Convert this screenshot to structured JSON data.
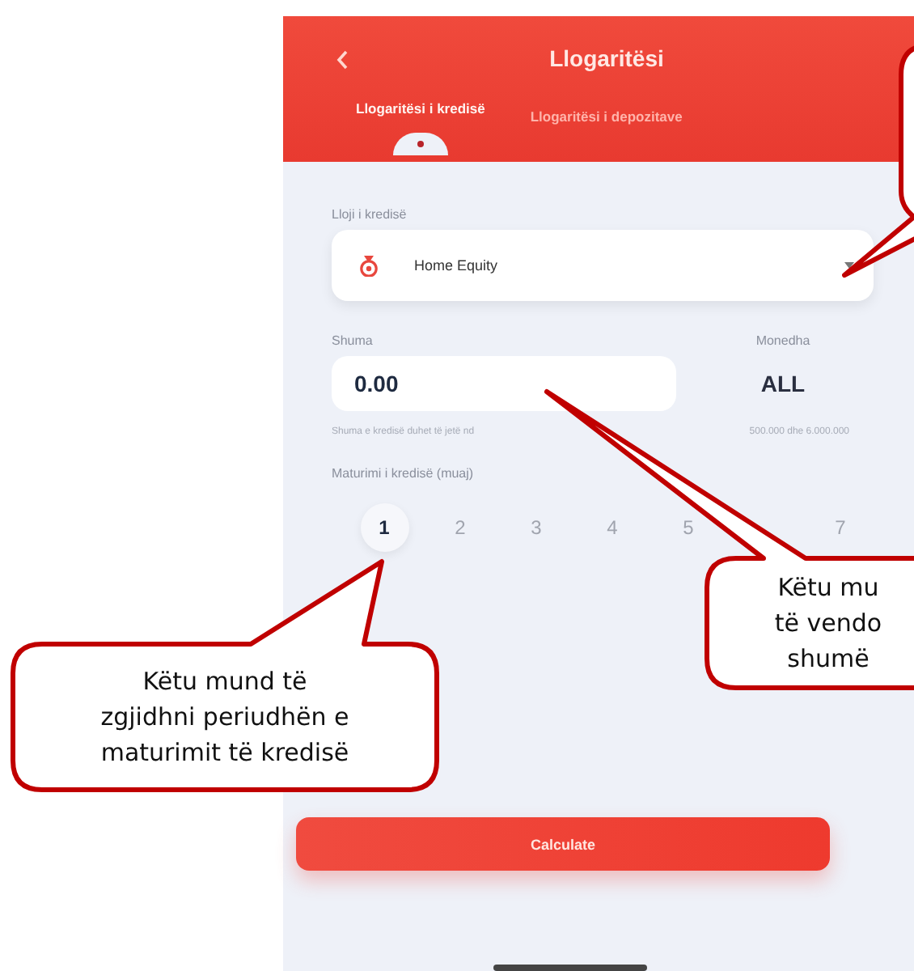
{
  "header": {
    "title": "Llogaritësi"
  },
  "tabs": [
    {
      "label": "Llogaritësi i kredisë",
      "selected": true
    },
    {
      "label": "Llogaritësi i depozitave",
      "selected": false
    }
  ],
  "loan_type": {
    "label": "Lloji i kredisë",
    "value": "Home Equity"
  },
  "amount": {
    "label": "Shuma",
    "value": "0.00"
  },
  "currency": {
    "label": "Monedha",
    "value": "ALL"
  },
  "hint": [
    "Shuma e kredisë duhet të jetë nd",
    "500.000 dhe 6.000.000"
  ],
  "maturity": {
    "label": "Maturimi i kredisë (muaj)",
    "months": [
      {
        "label": "1",
        "selected": true
      },
      {
        "label": "2",
        "selected": false
      },
      {
        "label": "3",
        "selected": false
      },
      {
        "label": "4",
        "selected": false
      },
      {
        "label": "5",
        "selected": false
      },
      {
        "label": "7",
        "selected": false
      }
    ]
  },
  "button": "Calculate",
  "callout_maturity": {
    "lines": [
      "Këtu mund të",
      "zgjidhni periudhën e",
      "maturimit të kredisë"
    ]
  },
  "callout_amount": {
    "lines": [
      "Këtu mu",
      "të vendo",
      "shumë"
    ]
  }
}
